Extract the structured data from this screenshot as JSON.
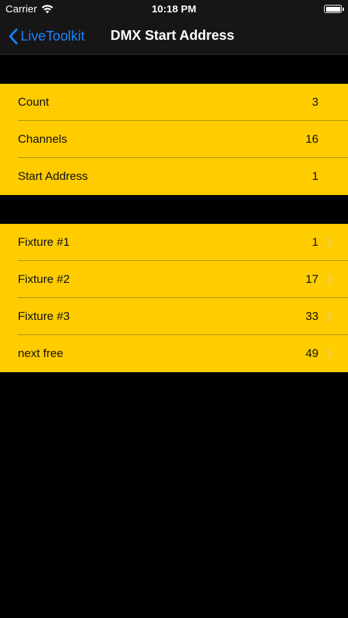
{
  "status_bar": {
    "carrier": "Carrier",
    "time": "10:18 PM"
  },
  "nav": {
    "back_label": "LiveToolkit",
    "title": "DMX Start Address"
  },
  "settings": [
    {
      "label": "Count",
      "value": "3"
    },
    {
      "label": "Channels",
      "value": "16"
    },
    {
      "label": "Start Address",
      "value": "1"
    }
  ],
  "fixtures": [
    {
      "label": "Fixture #1",
      "value": "1"
    },
    {
      "label": "Fixture #2",
      "value": "17"
    },
    {
      "label": "Fixture #3",
      "value": "33"
    },
    {
      "label": "next free",
      "value": "49"
    }
  ],
  "colors": {
    "accent": "#1a82fb",
    "group_background": "#ffcc00",
    "page_background": "#000000"
  }
}
